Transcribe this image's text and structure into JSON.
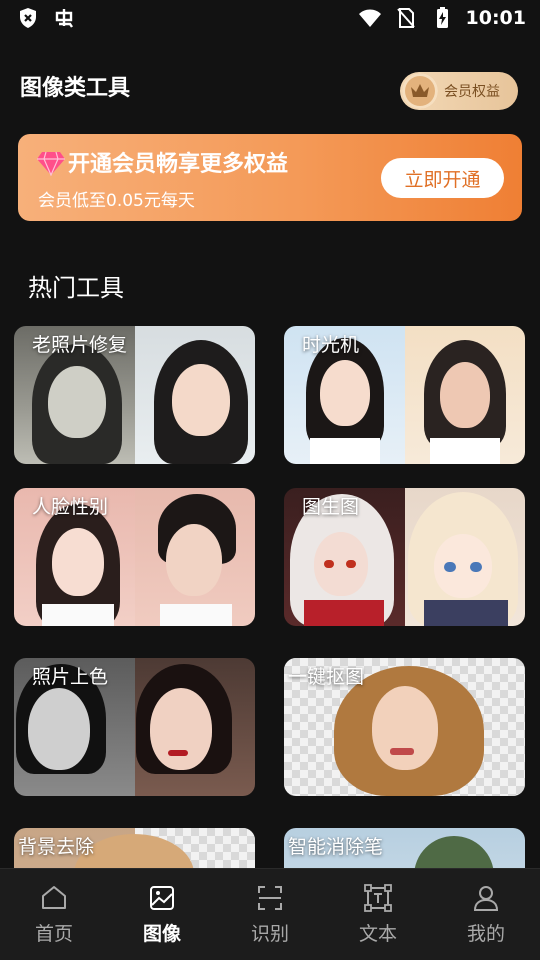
{
  "status_bar": {
    "time": "10:01"
  },
  "header": {
    "title": "图像类工具",
    "vip_label": "会员权益"
  },
  "banner": {
    "title": "开通会员畅享更多权益",
    "subtitle": "会员低至0.05元每天",
    "button": "立即开通"
  },
  "section": {
    "title": "热门工具"
  },
  "tools": [
    {
      "label": "老照片修复"
    },
    {
      "label": "时光机"
    },
    {
      "label": "人脸性别"
    },
    {
      "label": "图生图"
    },
    {
      "label": "照片上色"
    },
    {
      "label": "一键抠图"
    },
    {
      "label": "背景去除"
    },
    {
      "label": "智能消除笔"
    }
  ],
  "nav": [
    {
      "label": "首页",
      "icon": "home-icon"
    },
    {
      "label": "图像",
      "icon": "image-icon",
      "active": true
    },
    {
      "label": "识别",
      "icon": "scan-icon"
    },
    {
      "label": "文本",
      "icon": "text-frame-icon"
    },
    {
      "label": "我的",
      "icon": "user-icon"
    }
  ],
  "colors": {
    "accent_orange": "#ef7f34",
    "background": "#121212",
    "nav_bg": "#1c1c1c"
  }
}
